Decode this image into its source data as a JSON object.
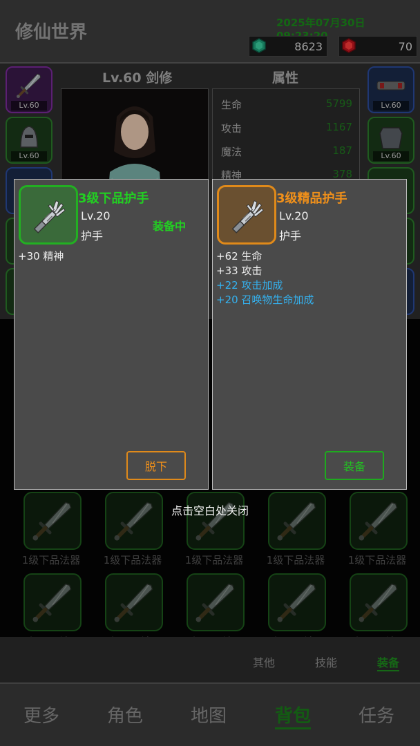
{
  "header": {
    "app_title": "修仙世界",
    "datetime": "2025年07月30日 09:23:20",
    "currencies": [
      {
        "icon": "green-gem-icon",
        "value": "8623",
        "color": "#1fa07a"
      },
      {
        "icon": "red-gem-icon",
        "value": "70",
        "color": "#c0141e"
      }
    ]
  },
  "character": {
    "class_label": "Lv.60 剑修",
    "attr_title": "属性",
    "left_slots": [
      {
        "icon": "sword-icon",
        "level": "Lv.60",
        "rarity": "purple"
      },
      {
        "icon": "helmet-icon",
        "level": "Lv.60",
        "rarity": "green"
      }
    ],
    "right_slots": [
      {
        "icon": "bracer-icon",
        "level": "Lv.60",
        "rarity": "blue"
      },
      {
        "icon": "armor-icon",
        "level": "Lv.60",
        "rarity": "green"
      }
    ],
    "attributes": [
      {
        "name": "生命",
        "value": "5799"
      },
      {
        "name": "攻击",
        "value": "1167"
      },
      {
        "name": "魔法",
        "value": "187"
      },
      {
        "name": "精神",
        "value": "378"
      }
    ]
  },
  "inventory": {
    "item_name": "1级下品法器"
  },
  "sub_tabs": [
    "其他",
    "技能",
    "装备"
  ],
  "nav": [
    "更多",
    "角色",
    "地图",
    "背包",
    "任务"
  ],
  "colors": {
    "accent_green": "#22d022",
    "orange": "#f0901a",
    "stat_blue": "#34b2f0",
    "nav_active": "#1a7a1a"
  },
  "popup_equipped": {
    "name": "3级下品护手",
    "level": "Lv.20",
    "type": "护手",
    "status": "装备中",
    "stats": [
      "+30 精神"
    ],
    "button": "脱下"
  },
  "popup_new": {
    "name": "3级精品护手",
    "level": "Lv.20",
    "type": "护手",
    "stats": [
      "+62 生命",
      "+33 攻击"
    ],
    "bonus_stats": [
      "+22 攻击加成",
      "+20 召唤物生命加成"
    ],
    "button": "装备"
  },
  "close_hint": "点击空白处关闭"
}
